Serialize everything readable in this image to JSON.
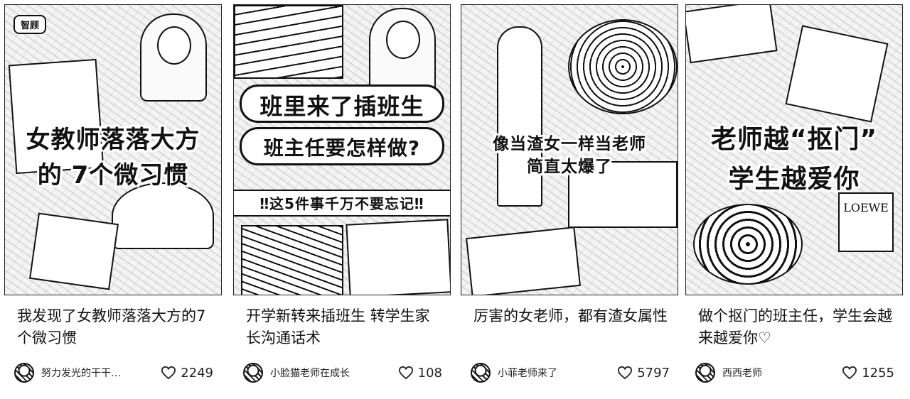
{
  "cards": [
    {
      "cover": {
        "badge": "智顾",
        "line1": "女教师落落大方",
        "line2": "的 7个微习惯"
      },
      "title": "我发现了女教师落落大方的7个微习惯",
      "author": "努力发光的干干…",
      "likes": "2249"
    },
    {
      "cover": {
        "line1": "班里来了插班生",
        "line2": "班主任要怎样做?",
        "banner": "‼这5件事千万不要忘记‼"
      },
      "title": "开学新转来插班生 转学生家长沟通话术",
      "author": "小脸猫老师在成长",
      "likes": "108"
    },
    {
      "cover": {
        "line1": "像当渣女一样当老师",
        "line2": "简直太爆了"
      },
      "title": "厉害的女老师，都有渣女属性",
      "author": "小菲老师来了",
      "likes": "5797"
    },
    {
      "cover": {
        "line1": "老师越“抠门”",
        "line2": "学生越爱你",
        "logo": "LOEWE"
      },
      "title": "做个抠门的班主任，学生会越来越爱你♡",
      "author": "西西老师",
      "likes": "1255"
    }
  ],
  "icons": {
    "like": "heart-outline-icon",
    "avatar": "user-avatar"
  }
}
